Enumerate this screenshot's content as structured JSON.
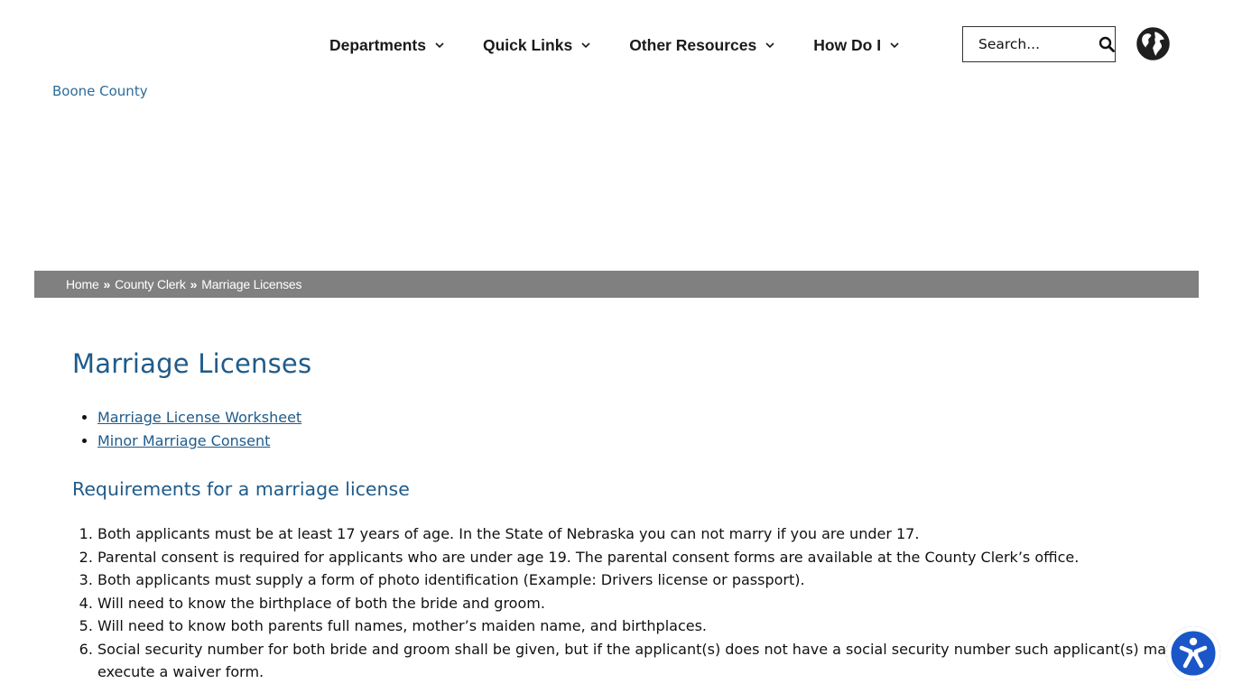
{
  "nav": {
    "items": [
      {
        "label": "Departments"
      },
      {
        "label": "Quick Links"
      },
      {
        "label": "Other Resources"
      },
      {
        "label": "How Do I"
      }
    ],
    "search_placeholder": "Search..."
  },
  "logo": {
    "alt": "Boone County"
  },
  "breadcrumb": {
    "home": "Home",
    "separator": "»",
    "parent": "County Clerk",
    "current": "Marriage Licenses"
  },
  "main": {
    "title": "Marriage Licenses",
    "links": [
      {
        "label": "Marriage License Worksheet"
      },
      {
        "label": "Minor Marriage Consent"
      }
    ],
    "requirements_heading": "Requirements for a marriage license",
    "requirements": [
      "Both applicants must be at least 17 years of age. In the State of Nebraska you can not marry if you are under 17.",
      "Parental consent is required for applicants who are under age 19. The parental consent forms are available at the County Clerk’s office.",
      "Both applicants must supply a form of photo identification (Example: Drivers license or passport).",
      "Will need to know the birthplace of both the bride and groom.",
      "Will need to know both parents full names, mother’s maiden name, and birthplaces.",
      "Social security number for both bride and groom shall be given, but if the applicant(s) does not have a social security number such applicant(s) may execute a waiver form."
    ]
  },
  "colors": {
    "heading": "#1f5b8a",
    "breadcrumb_bg": "#808080",
    "accessibility": "#1a56c8"
  },
  "icons": {
    "search": "search-icon",
    "globe": "globe-icon",
    "chevron": "chevron-down-icon",
    "accessibility": "accessibility-icon"
  }
}
